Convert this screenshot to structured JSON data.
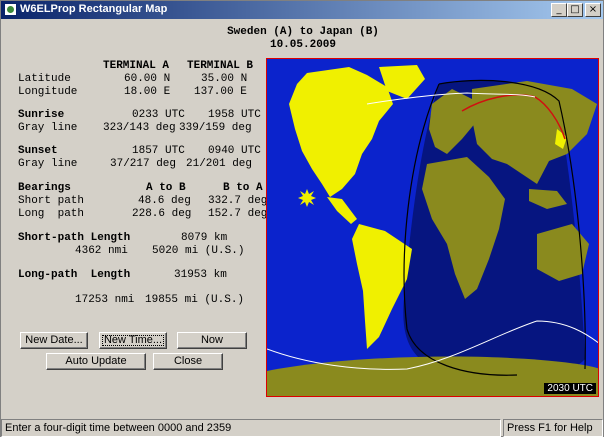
{
  "window": {
    "title": "W6ELProp Rectangular Map",
    "min_glyph": "_",
    "max_glyph": "□",
    "close_glyph": "×"
  },
  "heading": {
    "path": "Sweden (A) to Japan (B)",
    "date": "10.05.2009"
  },
  "table": {
    "col_a": "TERMINAL A",
    "col_b": "TERMINAL B",
    "latitude": {
      "label": "Latitude",
      "a": "60.00 N",
      "b": "35.00 N"
    },
    "longitude": {
      "label": "Longitude",
      "a": "18.00 E",
      "b": "137.00 E"
    },
    "sunrise": {
      "label": "Sunrise",
      "a": "0233 UTC",
      "b": "1958 UTC"
    },
    "grayline_rise": {
      "label": "Gray line",
      "a": "323/143 deg",
      "b": "339/159 deg"
    },
    "sunset": {
      "label": "Sunset",
      "a": "1857 UTC",
      "b": "0940 UTC"
    },
    "grayline_set": {
      "label": "Gray line",
      "a": "37/217 deg",
      "b": "21/201 deg"
    },
    "bearings": {
      "label": "Bearings",
      "a": "A to B",
      "b": "B to A"
    },
    "short_path": {
      "label": "Short path",
      "a": "48.6 deg",
      "b": "332.7 deg"
    },
    "long_path": {
      "label": "Long  path",
      "a": "228.6 deg",
      "b": "152.7 deg"
    }
  },
  "lengths": {
    "short_label": "Short-path Length",
    "short_km": "8079 km",
    "short_nmi": "4362 nmi",
    "short_mi": "5020 mi (U.S.)",
    "long_label": "Long-path  Length",
    "long_km": "31953 km",
    "long_nmi": "17253 nmi",
    "long_mi": "19855 mi (U.S.)"
  },
  "buttons": {
    "new_date": "New Date...",
    "new_time": "New Time...",
    "now": "Now",
    "auto_update": "Auto Update",
    "close": "Close"
  },
  "map": {
    "time_label": "2030 UTC",
    "colors": {
      "ocean": "#0b23cc",
      "land_day": "#f0f000",
      "land_night": "#8a8a1e",
      "night_ocean": "#061580"
    }
  },
  "status": {
    "hint": "Enter a four-digit time between 0000 and 2359",
    "help": "Press F1 for Help"
  }
}
